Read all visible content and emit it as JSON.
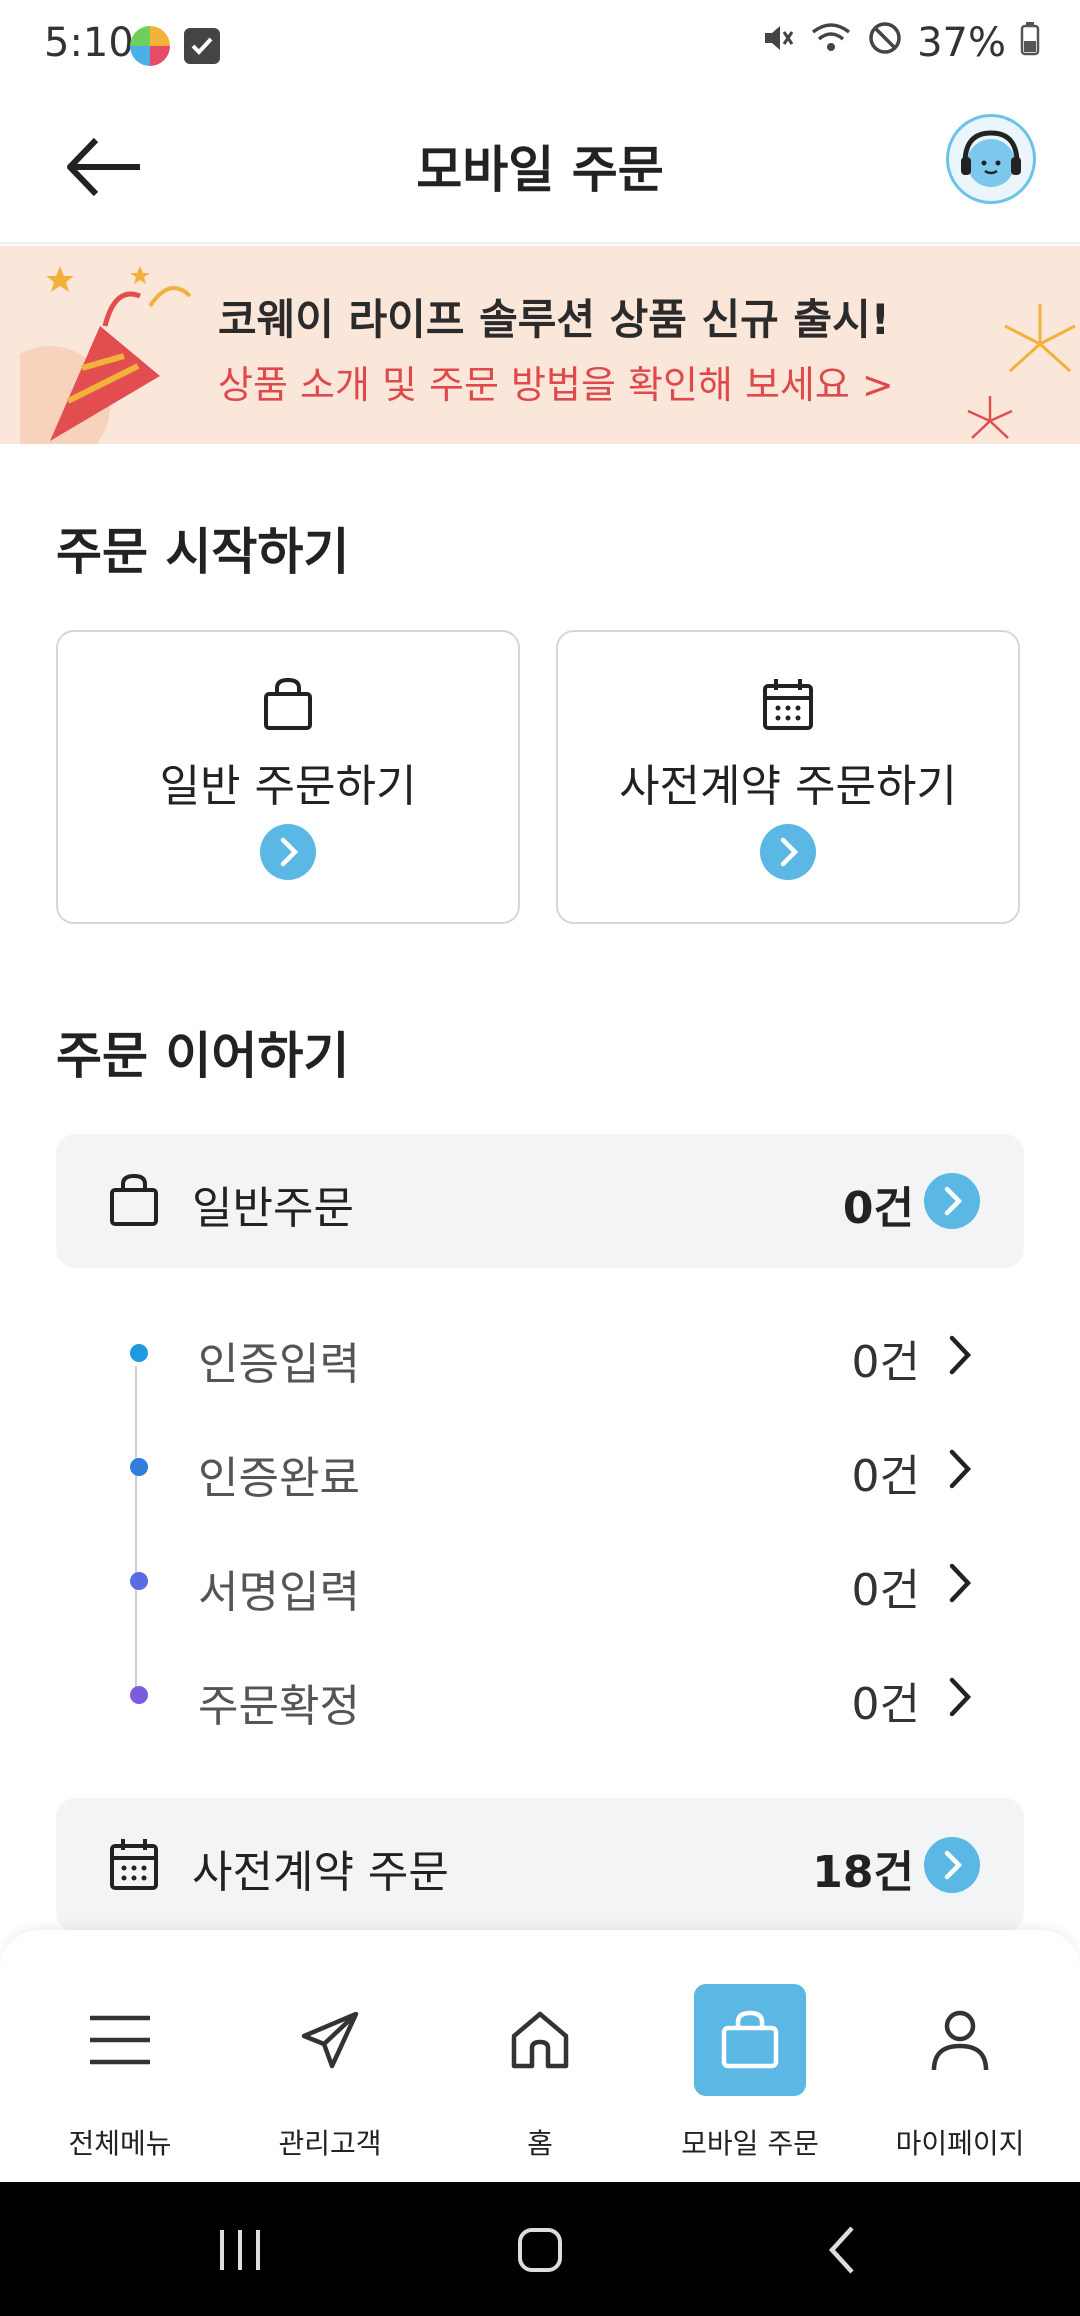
{
  "status_bar": {
    "time": "5:10",
    "battery": "37%"
  },
  "header": {
    "title": "모바일 주문"
  },
  "banner": {
    "title": "코웨이 라이프 솔루션 상품 신규 출시!",
    "subtitle": "상품 소개 및 주문 방법을 확인해 보세요 >"
  },
  "start_section": {
    "title": "주문 시작하기",
    "cards": [
      {
        "label": "일반 주문하기",
        "icon": "shopping-bag-icon"
      },
      {
        "label": "사전계약 주문하기",
        "icon": "calendar-icon"
      }
    ]
  },
  "continue_section": {
    "title": "주문 이어하기",
    "general": {
      "label": "일반주문",
      "count": "0건",
      "steps": [
        {
          "label": "인증입력",
          "count": "0건",
          "color": "#1e9be0"
        },
        {
          "label": "인증완료",
          "count": "0건",
          "color": "#2f7fdc"
        },
        {
          "label": "서명입력",
          "count": "0건",
          "color": "#5a6de0"
        },
        {
          "label": "주문확정",
          "count": "0건",
          "color": "#7a5ddf"
        }
      ]
    },
    "precontract": {
      "label": "사전계약 주문",
      "count": "18건"
    }
  },
  "bottom_nav": [
    {
      "label": "전체메뉴",
      "icon": "menu-icon",
      "active": false
    },
    {
      "label": "관리고객",
      "icon": "send-icon",
      "active": false
    },
    {
      "label": "홈",
      "icon": "home-icon",
      "active": false
    },
    {
      "label": "모바일 주문",
      "icon": "shopping-bag-icon",
      "active": true
    },
    {
      "label": "마이페이지",
      "icon": "person-icon",
      "active": false
    }
  ],
  "colors": {
    "accent": "#5bb7e4",
    "banner_bg": "#fbe6da",
    "banner_accent": "#e0494b"
  }
}
